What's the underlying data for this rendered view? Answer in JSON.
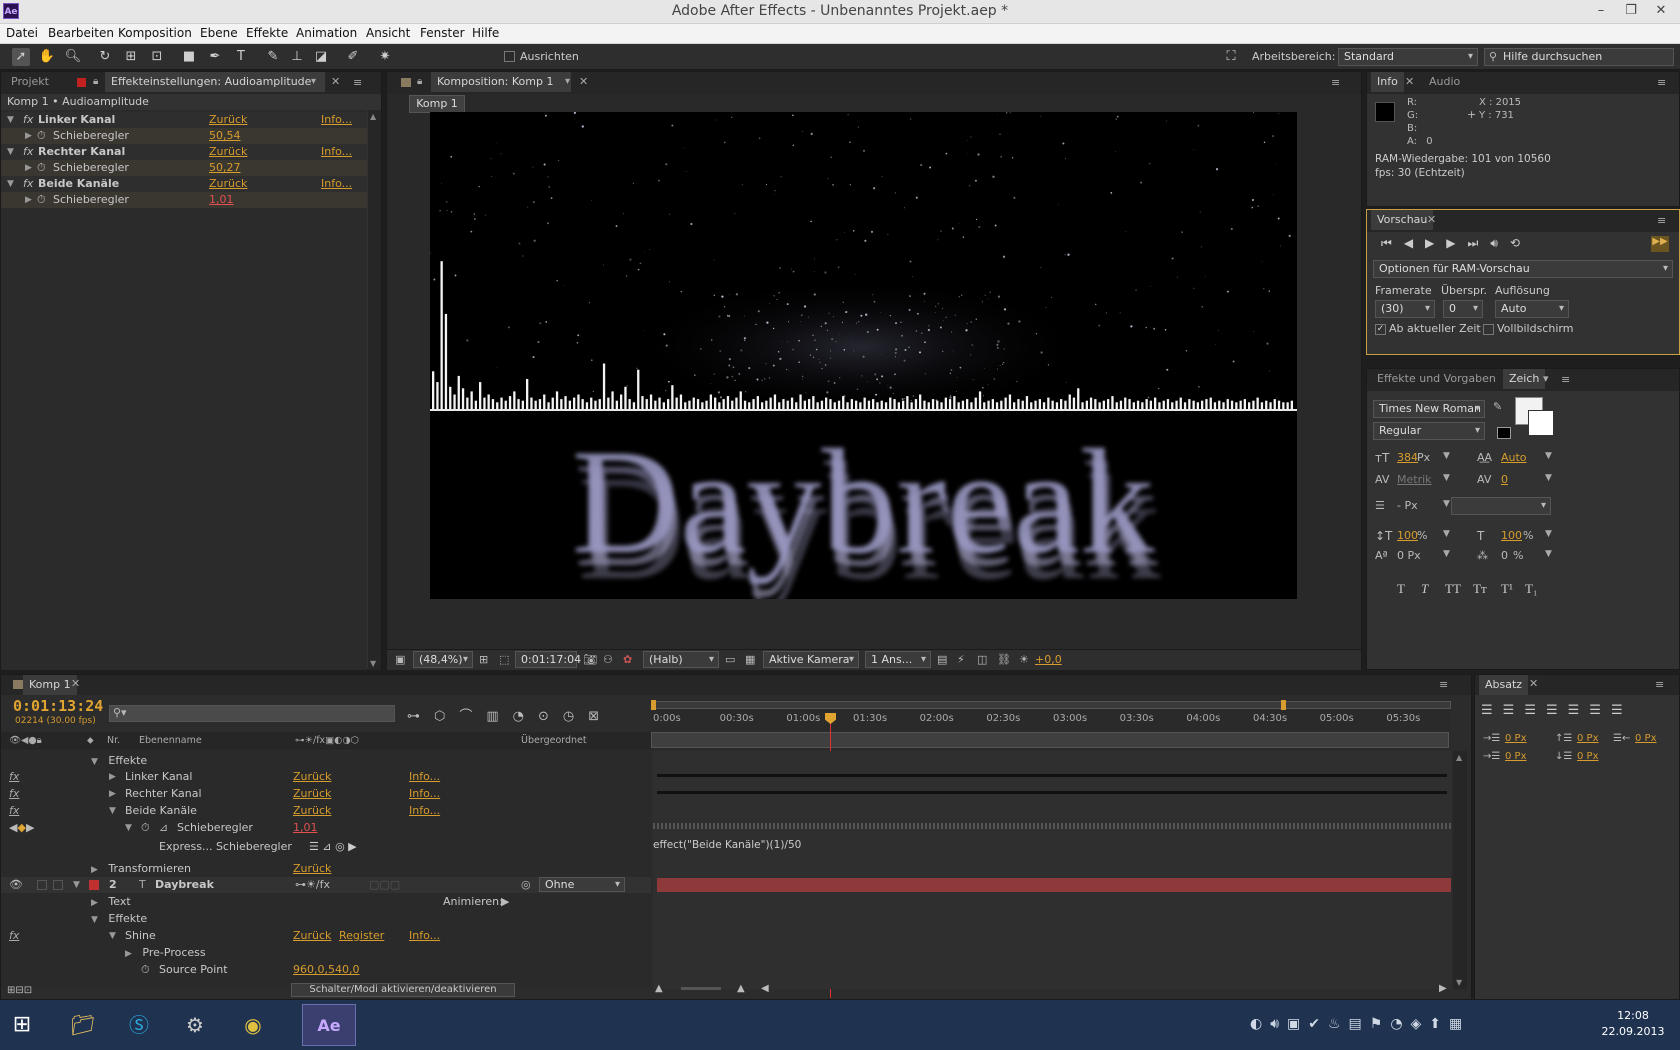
{
  "window": {
    "title": "Adobe After Effects - Unbenanntes Projekt.aep *",
    "app_icon": "Ae"
  },
  "menu": [
    "Datei",
    "Bearbeiten",
    "Komposition",
    "Ebene",
    "Effekte",
    "Animation",
    "Ansicht",
    "Fenster",
    "Hilfe"
  ],
  "toolbar": {
    "align_label": "Ausrichten",
    "workspace_label": "Arbeitsbereich:",
    "workspace_value": "Standard",
    "help_placeholder": "Hilfe durchsuchen"
  },
  "effects_panel": {
    "tab_project": "Projekt",
    "tab_effects": "Effekteinstellungen: Audioamplitude",
    "breadcrumb": "Komp 1 • Audioamplitude",
    "effects": [
      {
        "name": "Linker Kanal",
        "reset": "Zurück",
        "info": "Info...",
        "param": "Schieberegler",
        "value": "50,54"
      },
      {
        "name": "Rechter Kanal",
        "reset": "Zurück",
        "info": "Info...",
        "param": "Schieberegler",
        "value": "50,27"
      },
      {
        "name": "Beide Kanäle",
        "reset": "Zurück",
        "info": "Info...",
        "param": "Schieberegler",
        "value": "1,01"
      }
    ]
  },
  "comp_panel": {
    "tab": "Komposition: Komp 1",
    "subtab": "Komp 1",
    "zoom": "(48,4%)",
    "timecode": "0:01:17:04",
    "resolution": "(Halb)",
    "camera": "Aktive Kamera",
    "views": "1 Ans...",
    "exposure": "+0,0",
    "overlay_text": "Daybreak"
  },
  "info_panel": {
    "tab_info": "Info",
    "tab_audio": "Audio",
    "r": "R:",
    "g": "G:",
    "b": "B:",
    "a": "A:",
    "a_value": "0",
    "x": "X : 2015",
    "y": "Y : 731",
    "ram_line1": "RAM-Wiedergabe: 101 von 10560",
    "ram_line2": "fps: 30 (Echtzeit)"
  },
  "preview_panel": {
    "tab": "Vorschau",
    "options": "Optionen für RAM-Vorschau",
    "framerate_label": "Framerate",
    "skip_label": "Überspr.",
    "res_label": "Auflösung",
    "framerate_value": "(30)",
    "skip_value": "0",
    "res_value": "Auto",
    "from_current": "Ab aktueller Zeit",
    "fullscreen": "Vollbildschirm"
  },
  "char_panel": {
    "tab_effects": "Effekte und Vorgaben",
    "tab_char": "Zeich",
    "font": "Times New Roman",
    "style": "Regular",
    "size": "384",
    "size_unit": "Px",
    "leading": "Auto",
    "kerning": "Metrik",
    "tracking": "0",
    "stroke_unit": "- Px",
    "vscale": "100",
    "hscale": "100",
    "pct": "%",
    "baseline": "0 Px",
    "tsume": "0",
    "tsume_unit": "%",
    "styles": [
      "T",
      "T",
      "TT",
      "Tт",
      "T¹",
      "T₁"
    ]
  },
  "paragraph_panel": {
    "tab": "Absatz",
    "indent_values": [
      "0 Px",
      "0 Px",
      "0 Px",
      "0 Px",
      "0 Px"
    ]
  },
  "timeline": {
    "tab": "Komp 1",
    "timecode": "0:01:13:24",
    "frame_info": "02214 (30.00 fps)",
    "col_nr": "Nr.",
    "col_layer": "Ebenenname",
    "col_parent": "Übergeordnet",
    "ruler": [
      "0:00s",
      "00:30s",
      "01:00s",
      "01:30s",
      "02:00s",
      "02:30s",
      "03:00s",
      "03:30s",
      "04:00s",
      "04:30s",
      "05:00s",
      "05:30s"
    ],
    "rows": [
      {
        "label": "Effekte"
      },
      {
        "label": "Linker Kanal",
        "reset": "Zurück",
        "info": "Info..."
      },
      {
        "label": "Rechter Kanal",
        "reset": "Zurück",
        "info": "Info..."
      },
      {
        "label": "Beide Kanäle",
        "reset": "Zurück",
        "info": "Info..."
      },
      {
        "label": "Schieberegler",
        "value": "1,01"
      },
      {
        "label": "Express... Schieberegler",
        "expression": "effect(\"Beide Kanäle\")(1)/50"
      },
      {
        "label": "Transformieren",
        "reset": "Zurück"
      },
      {
        "label": "Daybreak",
        "nr": "2",
        "parent": "Ohne"
      },
      {
        "label": "Text",
        "animate": "Animieren:"
      },
      {
        "label": "Effekte"
      },
      {
        "label": "Shine",
        "reset": "Zurück",
        "register": "Register",
        "info": "Info..."
      },
      {
        "label": "Pre-Process"
      },
      {
        "label": "Source Point",
        "value": "960,0,540,0"
      }
    ],
    "footer": "Schalter/Modi aktivieren/deaktivieren"
  },
  "taskbar": {
    "time": "12:08",
    "date": "22.09.2013"
  },
  "colors": {
    "accent": "#d69c2d",
    "layer_bar": "#8f3a3a",
    "playhead": "#e03030"
  },
  "spectrum_bars": [
    0.25,
    0.18,
    0.96,
    0.62,
    0.15,
    0.1,
    0.22,
    0.14,
    0.08,
    0.12,
    0.06,
    0.18,
    0.08,
    0.1,
    0.07,
    0.05,
    0.08,
    0.06,
    0.09,
    0.12,
    0.07,
    0.06,
    0.2,
    0.08,
    0.06,
    0.07,
    0.1,
    0.05,
    0.08,
    0.12,
    0.07,
    0.09,
    0.06,
    0.08,
    0.1,
    0.07,
    0.05,
    0.08,
    0.06,
    0.07,
    0.3,
    0.08,
    0.12,
    0.06,
    0.1,
    0.15,
    0.07,
    0.05,
    0.26,
    0.09,
    0.07,
    0.1,
    0.06,
    0.08,
    0.05,
    0.07,
    0.16,
    0.08,
    0.1,
    0.05,
    0.06,
    0.08,
    0.07,
    0.05,
    0.06,
    0.1,
    0.08,
    0.05,
    0.07,
    0.09,
    0.06,
    0.08,
    0.12,
    0.06,
    0.05,
    0.07,
    0.09,
    0.05,
    0.06,
    0.08,
    0.1,
    0.05,
    0.07,
    0.06,
    0.08,
    0.05,
    0.1,
    0.06,
    0.07,
    0.09,
    0.05,
    0.06,
    0.08,
    0.07,
    0.05,
    0.06,
    0.09,
    0.05,
    0.07,
    0.06,
    0.05,
    0.08,
    0.06,
    0.07,
    0.05,
    0.06,
    0.05,
    0.08,
    0.07,
    0.05,
    0.06,
    0.09,
    0.05,
    0.07,
    0.1,
    0.06,
    0.05,
    0.07,
    0.06,
    0.05,
    0.08,
    0.07,
    0.09,
    0.05,
    0.06,
    0.07,
    0.05,
    0.08,
    0.12,
    0.05,
    0.06,
    0.07,
    0.05,
    0.06,
    0.08,
    0.1,
    0.05,
    0.07,
    0.06,
    0.09,
    0.05,
    0.06,
    0.07,
    0.05,
    0.08,
    0.06,
    0.05,
    0.07,
    0.06,
    0.1,
    0.08,
    0.14,
    0.05,
    0.06,
    0.08,
    0.07,
    0.05,
    0.06,
    0.07,
    0.09,
    0.05,
    0.06,
    0.08,
    0.07,
    0.05,
    0.06,
    0.05,
    0.07,
    0.06,
    0.08,
    0.05,
    0.06,
    0.07,
    0.05,
    0.06,
    0.08,
    0.05,
    0.07,
    0.06,
    0.05,
    0.06,
    0.07,
    0.08,
    0.05,
    0.06,
    0.05,
    0.07,
    0.06,
    0.05,
    0.06,
    0.07,
    0.05,
    0.06,
    0.08,
    0.05,
    0.06,
    0.05,
    0.07,
    0.06,
    0.05,
    0.05,
    0.06
  ]
}
